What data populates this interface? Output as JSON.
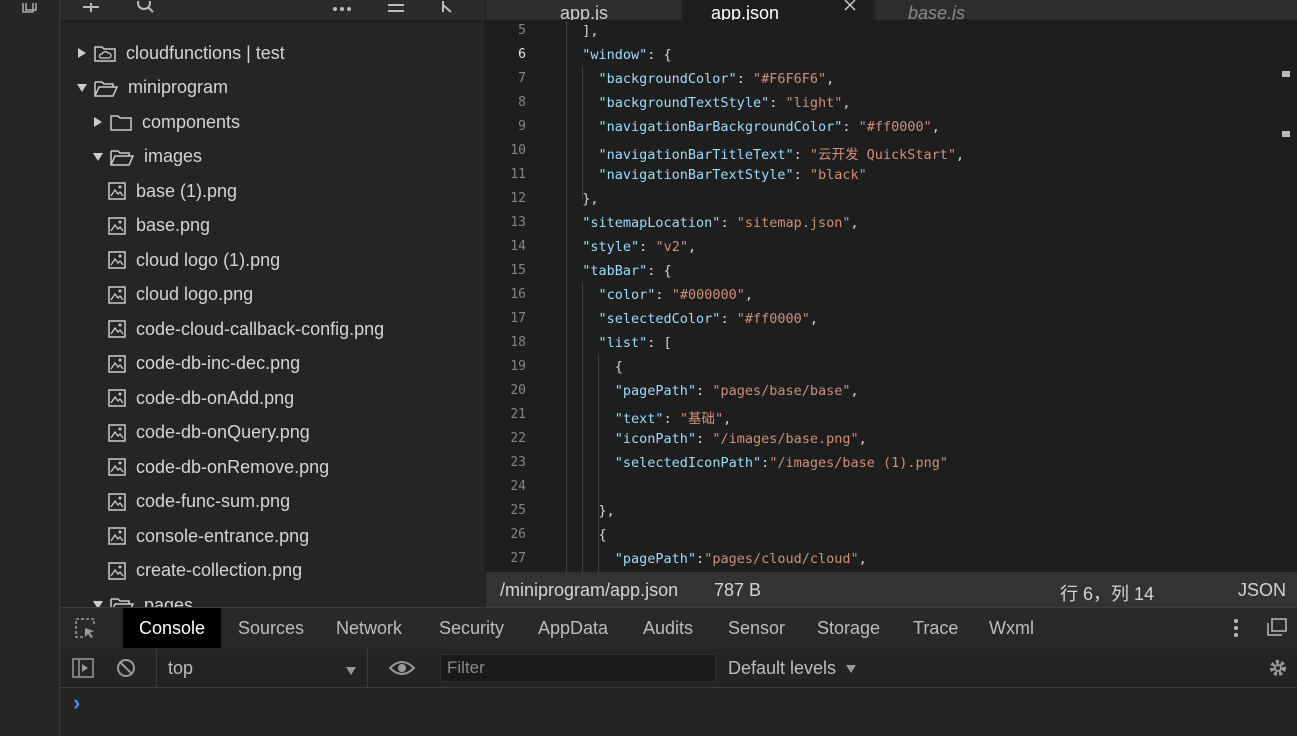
{
  "explorer": {
    "items": [
      {
        "label": "cloudfunctions | test",
        "kind": "folder-cloud",
        "expanded": false
      },
      {
        "label": "miniprogram",
        "kind": "folder",
        "expanded": true
      },
      {
        "label": "components",
        "kind": "folder",
        "expanded": false
      },
      {
        "label": "images",
        "kind": "folder",
        "expanded": true
      },
      {
        "label": "base (1).png",
        "kind": "image"
      },
      {
        "label": "base.png",
        "kind": "image"
      },
      {
        "label": "cloud logo (1).png",
        "kind": "image"
      },
      {
        "label": "cloud logo.png",
        "kind": "image"
      },
      {
        "label": "code-cloud-callback-config.png",
        "kind": "image"
      },
      {
        "label": "code-db-inc-dec.png",
        "kind": "image"
      },
      {
        "label": "code-db-onAdd.png",
        "kind": "image"
      },
      {
        "label": "code-db-onQuery.png",
        "kind": "image"
      },
      {
        "label": "code-db-onRemove.png",
        "kind": "image"
      },
      {
        "label": "code-func-sum.png",
        "kind": "image"
      },
      {
        "label": "console-entrance.png",
        "kind": "image"
      },
      {
        "label": "create-collection.png",
        "kind": "image"
      },
      {
        "label": "pages",
        "kind": "folder",
        "expanded": true
      }
    ]
  },
  "tabs": [
    {
      "label": "app.js"
    },
    {
      "label": "app.json",
      "active": true
    },
    {
      "label": "base.js",
      "italic": true
    }
  ],
  "editor": {
    "active_line": 6,
    "lines": [
      {
        "n": "5",
        "text": "  ],"
      },
      {
        "n": "6",
        "text": "  \"window\": {"
      },
      {
        "n": "7",
        "text": "    \"backgroundColor\": \"#F6F6F6\","
      },
      {
        "n": "8",
        "text": "    \"backgroundTextStyle\": \"light\","
      },
      {
        "n": "9",
        "text": "    \"navigationBarBackgroundColor\": \"#ff0000\","
      },
      {
        "n": "10",
        "text": "    \"navigationBarTitleText\": \"云开发 QuickStart\","
      },
      {
        "n": "11",
        "text": "    \"navigationBarTextStyle\": \"black\""
      },
      {
        "n": "12",
        "text": "  },"
      },
      {
        "n": "13",
        "text": "  \"sitemapLocation\": \"sitemap.json\","
      },
      {
        "n": "14",
        "text": "  \"style\": \"v2\","
      },
      {
        "n": "15",
        "text": "  \"tabBar\": {"
      },
      {
        "n": "16",
        "text": "    \"color\": \"#000000\","
      },
      {
        "n": "17",
        "text": "    \"selectedColor\": \"#ff0000\","
      },
      {
        "n": "18",
        "text": "    \"list\": ["
      },
      {
        "n": "19",
        "text": "      {"
      },
      {
        "n": "20",
        "text": "      \"pagePath\": \"pages/base/base\","
      },
      {
        "n": "21",
        "text": "      \"text\": \"基础\","
      },
      {
        "n": "22",
        "text": "      \"iconPath\": \"/images/base.png\","
      },
      {
        "n": "23",
        "text": "      \"selectedIconPath\":\"/images/base (1).png\""
      },
      {
        "n": "24",
        "text": ""
      },
      {
        "n": "25",
        "text": "    },"
      },
      {
        "n": "26",
        "text": "    {"
      },
      {
        "n": "27",
        "text": "      \"pagePath\":\"pages/cloud/cloud\","
      }
    ]
  },
  "statusbar": {
    "path": "/miniprogram/app.json",
    "size": "787 B",
    "position": "行 6，列 14",
    "language": "JSON"
  },
  "devtools": {
    "tabs": [
      "Console",
      "Sources",
      "Network",
      "Security",
      "AppData",
      "Audits",
      "Sensor",
      "Storage",
      "Trace",
      "Wxml"
    ],
    "active_tab": "Console",
    "context": "top",
    "filter_placeholder": "Filter",
    "levels": "Default levels",
    "prompt": "›"
  },
  "colors": {
    "key": "#9cdcfe",
    "string": "#ce9178",
    "accent": "#3794ff"
  }
}
